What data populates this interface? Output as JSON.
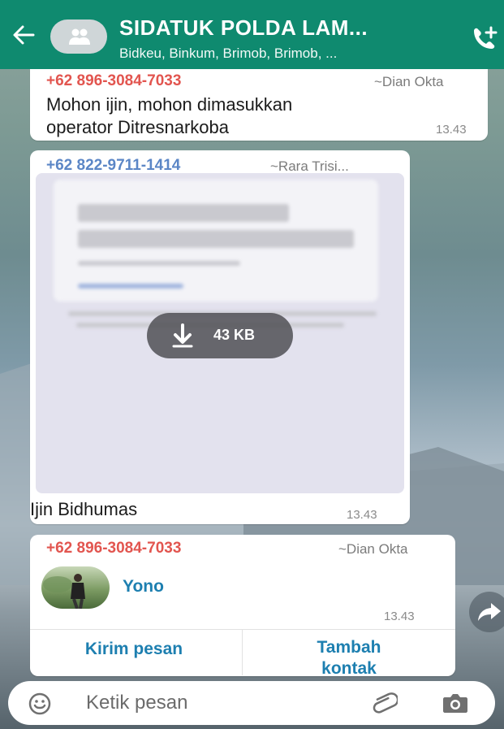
{
  "header": {
    "title": "SIDATUK POLDA LAM...",
    "subtitle": "Bidkeu, Binkum, Brimob, Brimob, ...",
    "back_icon": "back-arrow-icon",
    "group_icon": "group-avatar-icon",
    "call_icon": "add-call-icon",
    "color": "#0f8a6f"
  },
  "messages": [
    {
      "phone": "+62 896-3084-7033",
      "name": "~Dian Okta",
      "text_line1": "Mohon ijin, mohon dimasukkan",
      "text_line2": "operator Ditresnarkoba",
      "time": "13.43"
    },
    {
      "phone": "+62 822-9711-1414",
      "name": "~Rara Trisi...",
      "download_size": "43 KB",
      "caption": "Ijin Bidhumas",
      "time": "13.43"
    },
    {
      "phone": "+62 896-3084-7033",
      "name": "~Dian Okta",
      "contact_name": "Yono",
      "time": "13.43",
      "action_send": "Kirim pesan",
      "action_add_line1": "Tambah",
      "action_add_line2": "kontak"
    }
  ],
  "composer": {
    "placeholder": "Ketik pesan",
    "emoji_icon": "emoji-icon",
    "attach_icon": "paperclip-icon",
    "camera_icon": "camera-icon"
  },
  "colors": {
    "phone_red": "#e2554f",
    "phone_blue": "#5b86c6",
    "link_blue": "#1d7fb0"
  }
}
